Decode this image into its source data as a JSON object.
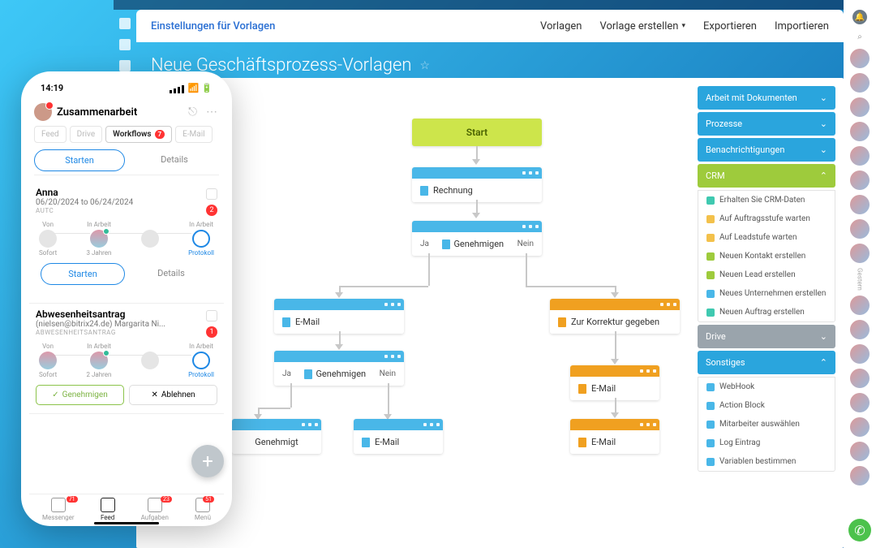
{
  "header": {
    "settings_tab": "Einstellungen für Vorlagen",
    "nav": {
      "vorlagen": "Vorlagen",
      "erstellen": "Vorlage erstellen",
      "exportieren": "Exportieren",
      "importieren": "Importieren"
    },
    "page_title": "Neue Geschäftsprozess-Vorlagen"
  },
  "flow": {
    "start": "Start",
    "rechnung": "Rechnung",
    "genehmigen1": {
      "ja": "Ja",
      "label": "Genehmigen",
      "nein": "Nein"
    },
    "email_left": "E-Mail",
    "korrektur": "Zur Korrektur gegeben",
    "genehmigen2": {
      "ja": "Ja",
      "label": "Genehmigen",
      "nein": "Nein"
    },
    "email_o1": "E-Mail",
    "genehmigt": "Genehmigt",
    "email_b2": "E-Mail",
    "email_o2": "E-Mail"
  },
  "accordion": {
    "docs": "Arbeit mit Dokumenten",
    "prozesse": "Prozesse",
    "benach": "Benachrichtigungen",
    "crm": "CRM",
    "crm_items": [
      "Erhalten Sie CRM-Daten",
      "Auf Auftragsstufe warten",
      "Auf Leadstufe warten",
      "Neuen Kontakt erstellen",
      "Neuen Lead erstellen",
      "Neues Unternehmen erstellen",
      "Neuen Auftrag erstellen"
    ],
    "drive": "Drive",
    "sonst": "Sonstiges",
    "sonst_items": [
      "WebHook",
      "Action Block",
      "Mitarbeiter auswählen",
      "Log Eintrag",
      "Variablen bestimmen"
    ]
  },
  "rail": {
    "sep": "Gestern"
  },
  "phone": {
    "time": "14:19",
    "title": "Zusammenarbeit",
    "tabs": {
      "feed": "Feed",
      "drive": "Drive",
      "workflows": "Workflows",
      "workflows_badge": "7",
      "email": "E-Mail"
    },
    "buttons": {
      "starten": "Starten",
      "details": "Details"
    },
    "card1": {
      "name": "Anna",
      "date": "06/20/2024 to 06/24/2024",
      "sub": "AUTC",
      "badge": "2",
      "tl": {
        "von": "Von",
        "inarbeit": "In Arbeit",
        "sofort": "Sofort",
        "jahre": "3 Jahren",
        "proto": "Protokoll"
      }
    },
    "card2": {
      "title": "Abwesenheitsantrag",
      "sub1": "(nielsen@bitrix24.de) Margarita Ni...",
      "sub2": "ABWESENHEITSANTRAG",
      "badge": "1",
      "tl": {
        "von": "Von",
        "inarbeit": "In Arbeit",
        "sofort": "Sofort",
        "jahre": "2 Jahren",
        "proto": "Protokoll"
      },
      "approve": "Genehmigen",
      "decline": "Ablehnen"
    },
    "nav": {
      "messenger": {
        "label": "Messenger",
        "badge": "71"
      },
      "feed": {
        "label": "Feed"
      },
      "aufgaben": {
        "label": "Aufgaben",
        "badge": "23"
      },
      "menu": {
        "label": "Menü",
        "badge": "51"
      }
    }
  }
}
